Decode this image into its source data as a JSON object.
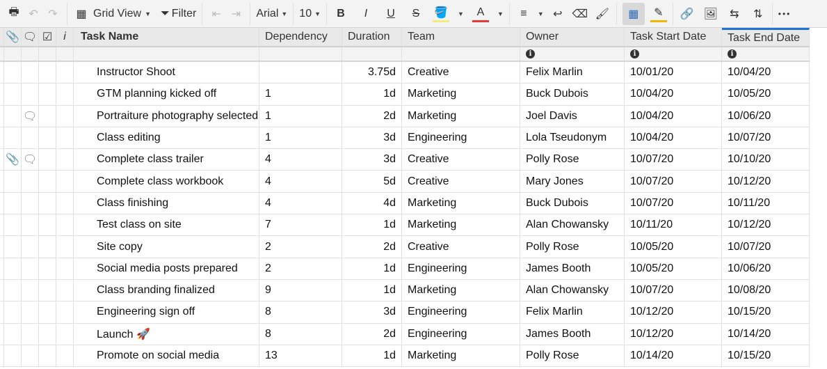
{
  "toolbar": {
    "grid_view": "Grid View",
    "filter": "Filter",
    "font": "Arial",
    "size": "10",
    "bold": "B",
    "italic": "I",
    "underline": "U",
    "strike": "S",
    "font_color": "A",
    "more": "•••"
  },
  "columns": {
    "task": "Task Name",
    "dependency": "Dependency",
    "duration": "Duration",
    "team": "Team",
    "owner": "Owner",
    "start": "Task Start Date",
    "end": "Task End Date",
    "info": "i"
  },
  "rows": [
    {
      "task": "Instructor Shoot",
      "dep": "",
      "dur": "3.75d",
      "team": "Creative",
      "owner": "Felix Marlin",
      "start": "10/01/20",
      "end": "10/04/20",
      "attach": "",
      "comment": ""
    },
    {
      "task": "GTM planning kicked off",
      "dep": "1",
      "dur": "1d",
      "team": "Marketing",
      "owner": "Buck Dubois",
      "start": "10/04/20",
      "end": "10/05/20",
      "attach": "",
      "comment": ""
    },
    {
      "task": "Portraiture photography selected",
      "dep": "1",
      "dur": "2d",
      "team": "Marketing",
      "owner": "Joel Davis",
      "start": "10/04/20",
      "end": "10/06/20",
      "attach": "",
      "comment": "🗨"
    },
    {
      "task": "Class editing",
      "dep": "1",
      "dur": "3d",
      "team": "Engineering",
      "owner": "Lola Tseudonym",
      "start": "10/04/20",
      "end": "10/07/20",
      "attach": "",
      "comment": ""
    },
    {
      "task": "Complete class trailer",
      "dep": "4",
      "dur": "3d",
      "team": "Creative",
      "owner": "Polly Rose",
      "start": "10/07/20",
      "end": "10/10/20",
      "attach": "📎",
      "comment": "🗨"
    },
    {
      "task": "Complete class workbook",
      "dep": "4",
      "dur": "5d",
      "team": "Creative",
      "owner": "Mary Jones",
      "start": "10/07/20",
      "end": "10/12/20",
      "attach": "",
      "comment": ""
    },
    {
      "task": "Class finishing",
      "dep": "4",
      "dur": "4d",
      "team": "Marketing",
      "owner": "Buck Dubois",
      "start": "10/07/20",
      "end": "10/11/20",
      "attach": "",
      "comment": ""
    },
    {
      "task": "Test class on site",
      "dep": "7",
      "dur": "1d",
      "team": "Marketing",
      "owner": "Alan Chowansky",
      "start": "10/11/20",
      "end": "10/12/20",
      "attach": "",
      "comment": ""
    },
    {
      "task": "Site copy",
      "dep": "2",
      "dur": "2d",
      "team": "Creative",
      "owner": "Polly Rose",
      "start": "10/05/20",
      "end": "10/07/20",
      "attach": "",
      "comment": ""
    },
    {
      "task": "Social media posts prepared",
      "dep": "2",
      "dur": "1d",
      "team": "Engineering",
      "owner": "James Booth",
      "start": "10/05/20",
      "end": "10/06/20",
      "attach": "",
      "comment": ""
    },
    {
      "task": "Class branding finalized",
      "dep": "9",
      "dur": "1d",
      "team": "Marketing",
      "owner": "Alan Chowansky",
      "start": "10/07/20",
      "end": "10/08/20",
      "attach": "",
      "comment": ""
    },
    {
      "task": "Engineering sign off",
      "dep": "8",
      "dur": "3d",
      "team": "Engineering",
      "owner": "Felix Marlin",
      "start": "10/12/20",
      "end": "10/15/20",
      "attach": "",
      "comment": ""
    },
    {
      "task": "Launch 🚀",
      "dep": "8",
      "dur": "2d",
      "team": "Engineering",
      "owner": "James Booth",
      "start": "10/12/20",
      "end": "10/14/20",
      "attach": "",
      "comment": ""
    },
    {
      "task": "Promote on social media",
      "dep": "13",
      "dur": "1d",
      "team": "Marketing",
      "owner": "Polly Rose",
      "start": "10/14/20",
      "end": "10/15/20",
      "attach": "",
      "comment": ""
    }
  ]
}
